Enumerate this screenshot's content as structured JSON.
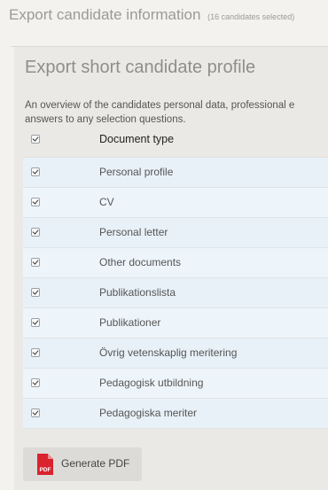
{
  "window": {
    "title": "Export candidate information",
    "selection_count": "(16 candidates selected)"
  },
  "section": {
    "title": "Export short candidate profile",
    "description_line1": "An overview of the candidates personal data, professional e",
    "description_line2": "answers to any selection questions."
  },
  "table": {
    "header": {
      "label": "Document type",
      "checked": true
    },
    "rows": [
      {
        "label": "Personal profile",
        "checked": true
      },
      {
        "label": "CV",
        "checked": true
      },
      {
        "label": "Personal letter",
        "checked": true
      },
      {
        "label": "Other documents",
        "checked": true
      },
      {
        "label": "Publikationslista",
        "checked": true
      },
      {
        "label": "Publikationer",
        "checked": true
      },
      {
        "label": "Övrig vetenskaplig meritering",
        "checked": true
      },
      {
        "label": "Pedagogisk utbildning",
        "checked": true
      },
      {
        "label": "Pedagogiska meriter",
        "checked": true
      }
    ]
  },
  "actions": {
    "generate_pdf_label": "Generate PDF",
    "pdf_icon_text": "PDF",
    "pdf_icon": "pdf-file-icon"
  },
  "colors": {
    "row_background": "#e8f1f8",
    "pdf_icon_red": "#d9232e"
  }
}
